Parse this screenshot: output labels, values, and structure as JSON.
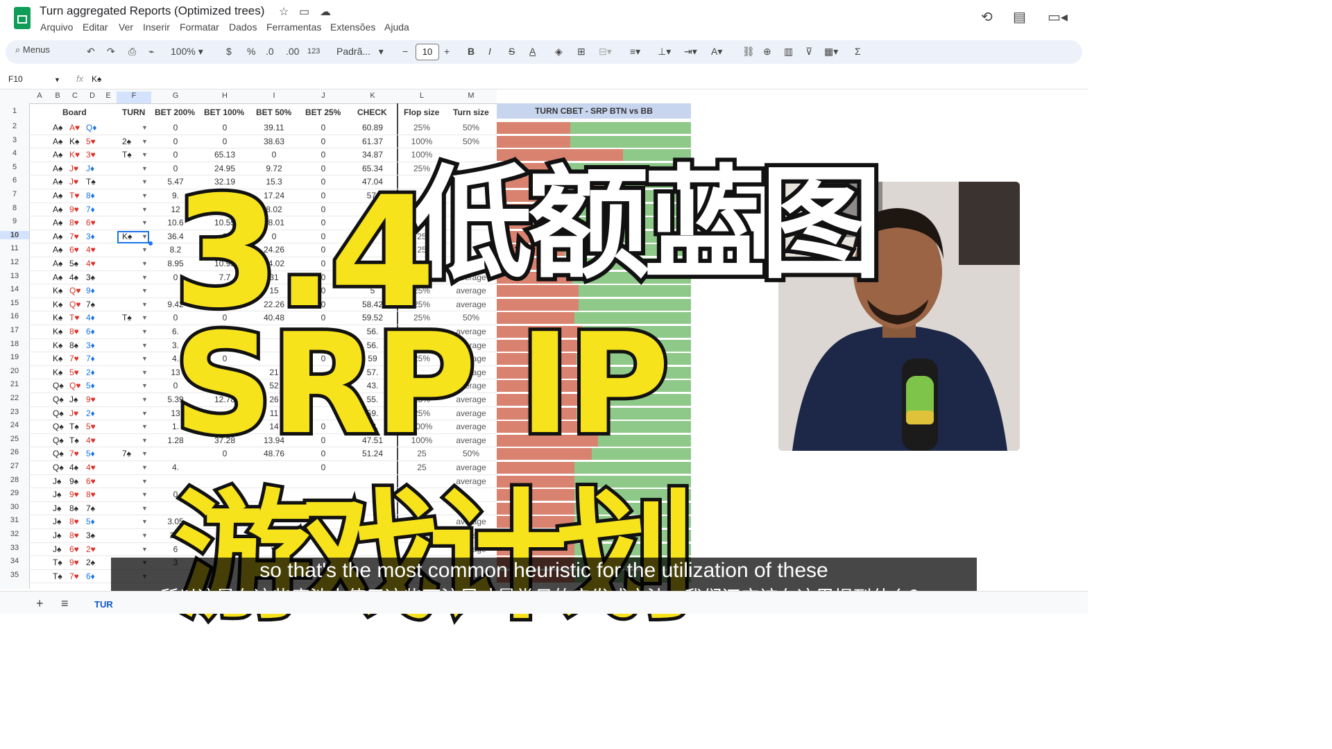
{
  "app": {
    "title": "Turn aggregated Reports (Optimized trees)",
    "menu": [
      "Arquivo",
      "Editar",
      "Ver",
      "Inserir",
      "Formatar",
      "Dados",
      "Ferramentas",
      "Extensões",
      "Ajuda"
    ]
  },
  "toolbar": {
    "search": "Menus",
    "zoom": "100%",
    "currency": "$",
    "percent": "%",
    "dec_less": ".0",
    "dec_more": ".00",
    "number_format": "123",
    "font": "Padrã...",
    "font_size": "10"
  },
  "formula": {
    "cell": "F10",
    "fx": "fx",
    "value": "K♠"
  },
  "columns": [
    "A",
    "B",
    "C",
    "D",
    "E",
    "F",
    "G",
    "H",
    "I",
    "J",
    "K",
    "L",
    "M"
  ],
  "headers": {
    "board": "Board",
    "turn": "TURN",
    "bet200": "BET 200%",
    "bet100": "BET 100%",
    "bet50": "BET 50%",
    "bet25": "BET 25%",
    "check": "CHECK",
    "flop_size": "Flop size",
    "turn_size": "Turn size",
    "bar_title": "TURN CBET - SRP BTN vs BB"
  },
  "rows": [
    {
      "n": "2",
      "b": [
        "A♠",
        "A♥",
        "Q♦"
      ],
      "t": "",
      "g": "0",
      "h": "0",
      "i": "39.11",
      "j": "0",
      "k": "60.89",
      "l": "25%",
      "m": "50%",
      "bar": 0.38
    },
    {
      "n": "3",
      "b": [
        "A♠",
        "K♠",
        "5♥"
      ],
      "t": "2♠",
      "g": "0",
      "h": "0",
      "i": "38.63",
      "j": "0",
      "k": "61.37",
      "l": "100%",
      "m": "50%",
      "bar": 0.38
    },
    {
      "n": "4",
      "b": [
        "A♠",
        "K♥",
        "3♥"
      ],
      "t": "T♠",
      "g": "0",
      "h": "65.13",
      "i": "0",
      "j": "0",
      "k": "34.87",
      "l": "100%",
      "m": "",
      "bar": 0.65
    },
    {
      "n": "5",
      "b": [
        "A♠",
        "J♥",
        "J♦"
      ],
      "t": "",
      "g": "0",
      "h": "24.95",
      "i": "9.72",
      "j": "0",
      "k": "65.34",
      "l": "25%",
      "m": "",
      "bar": 0.35
    },
    {
      "n": "6",
      "b": [
        "A♠",
        "J♥",
        "T♠"
      ],
      "t": "",
      "g": "5.47",
      "h": "32.19",
      "i": "15.3",
      "j": "0",
      "k": "47.04",
      "l": "",
      "m": "",
      "bar": 0.53
    },
    {
      "n": "7",
      "b": [
        "A♠",
        "T♥",
        "8♦"
      ],
      "t": "",
      "g": "9.",
      "h": "",
      "i": "17.24",
      "j": "0",
      "k": "57.",
      "l": "",
      "m": "",
      "bar": 0.43
    },
    {
      "n": "8",
      "b": [
        "A♠",
        "9♥",
        "7♦"
      ],
      "t": "",
      "g": "12",
      "h": "",
      "i": "8.02",
      "j": "0",
      "k": "6",
      "l": "25",
      "m": "",
      "bar": 0.4
    },
    {
      "n": "9",
      "b": [
        "A♠",
        "8♥",
        "6♥"
      ],
      "t": "",
      "g": "10.6",
      "h": "10.55",
      "i": "18.01",
      "j": "0",
      "k": "6",
      "l": "25",
      "m": "",
      "bar": 0.4
    },
    {
      "n": "10",
      "b": [
        "A♠",
        "7♥",
        "3♦"
      ],
      "t": "K♠",
      "g": "36.4",
      "h": "0",
      "i": "0",
      "j": "0",
      "k": "6",
      "l": "25",
      "m": "",
      "bar": 0.36
    },
    {
      "n": "11",
      "b": [
        "A♠",
        "6♥",
        "4♥"
      ],
      "t": "",
      "g": "8.2",
      "h": "",
      "i": "24.26",
      "j": "0",
      "k": "",
      "l": "25",
      "m": "",
      "bar": 0.35
    },
    {
      "n": "12",
      "b": [
        "A♠",
        "5♠",
        "4♥"
      ],
      "t": "",
      "g": "8.95",
      "h": "10.93",
      "i": "24.02",
      "j": "0",
      "k": "",
      "l": "25%",
      "m": "average",
      "bar": 0.44
    },
    {
      "n": "13",
      "b": [
        "A♠",
        "4♠",
        "3♠"
      ],
      "t": "",
      "g": "0",
      "h": "7.7",
      "i": "31",
      "j": "0",
      "k": "6",
      "l": "25%",
      "m": "average",
      "bar": 0.39
    },
    {
      "n": "14",
      "b": [
        "K♠",
        "Q♥",
        "9♦"
      ],
      "t": "",
      "g": "",
      "h": "",
      "i": "15",
      "j": "0",
      "k": "5",
      "l": "25%",
      "m": "average",
      "bar": 0.42
    },
    {
      "n": "15",
      "b": [
        "K♠",
        "Q♥",
        "7♠"
      ],
      "t": "",
      "g": "9.42",
      "h": "9.9",
      "i": "22.26",
      "j": "0",
      "k": "58.42",
      "l": "25%",
      "m": "average",
      "bar": 0.42
    },
    {
      "n": "16",
      "b": [
        "K♠",
        "T♥",
        "4♦"
      ],
      "t": "T♠",
      "g": "0",
      "h": "0",
      "i": "40.48",
      "j": "0",
      "k": "59.52",
      "l": "25%",
      "m": "50%",
      "bar": 0.4
    },
    {
      "n": "17",
      "b": [
        "K♠",
        "8♥",
        "6♦"
      ],
      "t": "",
      "g": "6.",
      "h": "22",
      "i": "",
      "j": "",
      "k": "56.",
      "l": "",
      "m": "average",
      "bar": 0.44
    },
    {
      "n": "18",
      "b": [
        "K♠",
        "8♠",
        "3♦"
      ],
      "t": "",
      "g": "3.",
      "h": "26",
      "i": "",
      "j": "",
      "k": "56.",
      "l": "",
      "m": "average",
      "bar": 0.44
    },
    {
      "n": "19",
      "b": [
        "K♠",
        "7♥",
        "7♦"
      ],
      "t": "",
      "g": "4.",
      "h": "0",
      "i": "",
      "j": "0",
      "k": "59",
      "l": "25%",
      "m": "average",
      "bar": 0.41
    },
    {
      "n": "20",
      "b": [
        "K♠",
        "5♥",
        "2♦"
      ],
      "t": "",
      "g": "13",
      "h": "",
      "i": "21",
      "j": "",
      "k": "57.",
      "l": "",
      "m": "average",
      "bar": 0.43
    },
    {
      "n": "21",
      "b": [
        "Q♠",
        "Q♥",
        "5♦"
      ],
      "t": "",
      "g": "0",
      "h": "",
      "i": "52",
      "j": "",
      "k": "43.",
      "l": "",
      "m": "average",
      "bar": 0.57
    },
    {
      "n": "22",
      "b": [
        "Q♠",
        "J♠",
        "9♥"
      ],
      "t": "",
      "g": "5.39",
      "h": "12.78",
      "i": "26",
      "j": "",
      "k": "55.",
      "l": "25%",
      "m": "average",
      "bar": 0.45
    },
    {
      "n": "23",
      "b": [
        "Q♠",
        "J♥",
        "2♦"
      ],
      "t": "",
      "g": "13",
      "h": "",
      "i": "11",
      "j": "",
      "k": "59.",
      "l": "25%",
      "m": "average",
      "bar": 0.41
    },
    {
      "n": "24",
      "b": [
        "Q♠",
        "T♠",
        "5♥"
      ],
      "t": "",
      "g": "1.",
      "h": "",
      "i": "14",
      "j": "0",
      "k": "48.",
      "l": "100%",
      "m": "average",
      "bar": 0.52
    },
    {
      "n": "25",
      "b": [
        "Q♠",
        "T♠",
        "4♥"
      ],
      "t": "",
      "g": "1.28",
      "h": "37.28",
      "i": "13.94",
      "j": "0",
      "k": "47.51",
      "l": "100%",
      "m": "average",
      "bar": 0.52
    },
    {
      "n": "26",
      "b": [
        "Q♠",
        "7♥",
        "5♦"
      ],
      "t": "7♠",
      "g": "",
      "h": "0",
      "i": "48.76",
      "j": "0",
      "k": "51.24",
      "l": "25",
      "m": "50%",
      "bar": 0.49
    },
    {
      "n": "27",
      "b": [
        "Q♠",
        "4♠",
        "4♥"
      ],
      "t": "",
      "g": "4.",
      "h": "",
      "i": "",
      "j": "0",
      "k": "",
      "l": "25",
      "m": "average",
      "bar": 0.4
    },
    {
      "n": "28",
      "b": [
        "J♠",
        "9♠",
        "6♥"
      ],
      "t": "",
      "g": "",
      "h": "",
      "i": "",
      "j": "",
      "k": "",
      "l": "",
      "m": "average",
      "bar": 0.4
    },
    {
      "n": "29",
      "b": [
        "J♠",
        "9♥",
        "8♥"
      ],
      "t": "",
      "g": "0",
      "h": "",
      "i": "",
      "j": "",
      "k": "",
      "l": "",
      "m": "",
      "bar": 0.4
    },
    {
      "n": "30",
      "b": [
        "J♠",
        "8♠",
        "7♠"
      ],
      "t": "",
      "g": "",
      "h": "",
      "i": "",
      "j": "",
      "k": "",
      "l": "",
      "m": "",
      "bar": 0.4
    },
    {
      "n": "31",
      "b": [
        "J♠",
        "8♥",
        "5♦"
      ],
      "t": "",
      "g": "3.05",
      "h": "",
      "i": "",
      "j": "",
      "k": "",
      "l": "50%",
      "m": "average",
      "bar": 0.4
    },
    {
      "n": "32",
      "b": [
        "J♠",
        "8♥",
        "3♠"
      ],
      "t": "",
      "g": "2.4",
      "h": "",
      "i": "",
      "j": "",
      "k": "",
      "l": "100%",
      "m": "average",
      "bar": 0.4
    },
    {
      "n": "33",
      "b": [
        "J♠",
        "6♥",
        "2♥"
      ],
      "t": "",
      "g": "6",
      "h": "",
      "i": "",
      "j": "",
      "k": "",
      "l": "",
      "m": "average",
      "bar": 0.4
    },
    {
      "n": "34",
      "b": [
        "T♠",
        "9♥",
        "2♠"
      ],
      "t": "",
      "g": "3",
      "h": "",
      "i": "",
      "j": "",
      "k": "",
      "l": "",
      "m": "",
      "bar": 0.4
    },
    {
      "n": "35",
      "b": [
        "T♠",
        "7♥",
        "6♦"
      ],
      "t": "",
      "g": "",
      "h": "",
      "i": "",
      "j": "",
      "k": "",
      "l": "",
      "m": "",
      "bar": 0.4
    }
  ],
  "overlay": {
    "line1": "低额蓝图",
    "line2": "3.4",
    "line3": "SRP IP",
    "line4": "游戏计划"
  },
  "subtitles": {
    "en": "so that's the most common heuristic for the utilization of these",
    "zh": "所以这是在这些底池中使用这些下注尺寸最常见的启发式方法。我们还应该在这里提到什么？"
  },
  "sheet_tab": "TUR",
  "colors": {
    "bar_red": "#d9826f",
    "bar_green": "#8fc98a",
    "overlay_yellow": "#f7e31b"
  }
}
